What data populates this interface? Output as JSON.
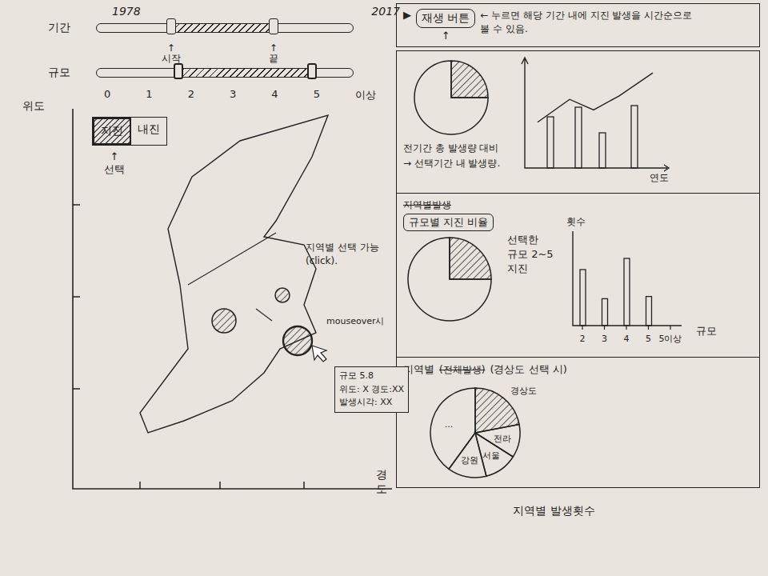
{
  "period": {
    "label": "기간",
    "start_year": "1978",
    "end_year": "2017",
    "start_label": "시작",
    "end_label": "끝",
    "start_level": 0.29,
    "end_level": 0.69
  },
  "magnitude": {
    "label": "규모",
    "ticks": [
      "0",
      "1",
      "2",
      "3",
      "4",
      "5",
      "이상"
    ],
    "start_level": 0.32,
    "end_level": 0.84
  },
  "map": {
    "y_axis": "위도",
    "x_axis": "경도",
    "toggle": [
      {
        "label": "지진",
        "selected": true
      },
      {
        "label": "내진",
        "selected": false
      }
    ],
    "toggle_arrow": "↑",
    "toggle_note": "선택",
    "region_note": "지역별 선택 가능",
    "region_note_2": "(click).",
    "hover_note": "mouseover시",
    "markers": [
      {
        "hovered": false
      },
      {
        "hovered": false
      },
      {
        "hovered": true
      }
    ],
    "tooltip": {
      "magnitude": "규모 5.8",
      "coords": "위도: X 경도:XX",
      "time": "발생시각: XX"
    }
  },
  "play": {
    "icon": "▶",
    "label": "재생 버튼",
    "arrow": "↑",
    "note": "← 누르면 해당 기간 내에 지진 발생을 시간순으로",
    "note_2": "볼 수 있음."
  },
  "period_panel": {
    "slices": [
      {
        "share": 0.25,
        "selected": true
      },
      {
        "share": 0.75,
        "selected": false
      }
    ],
    "bars": [
      3.2,
      3.8,
      2.2,
      3.9
    ],
    "line": [
      2.6,
      3.9,
      3.3,
      4.1,
      5.4
    ],
    "x_axis": "연도",
    "caption": "전기간 총 발생량 대비",
    "caption_2": "→ 선택기간 내 발생량."
  },
  "magnitude_panel": {
    "struck": "지역별발생",
    "title": "규모별 지진 비율",
    "slices": [
      {
        "share": 0.25,
        "selected": true
      },
      {
        "share": 0.75,
        "selected": false
      }
    ],
    "annotation": "선택한",
    "annotation_2": "규모 2~5",
    "annotation_3": "지진",
    "y_axis": "횟수",
    "x_axis": "규모",
    "ticks": [
      "2",
      "3",
      "4",
      "5",
      "5이상"
    ],
    "bars": [
      2.5,
      1.2,
      3.0,
      1.3,
      0
    ]
  },
  "region_panel": {
    "title": "지역별",
    "struck": "(전체발생)",
    "note": "(경상도 선택 시)",
    "slices": [
      {
        "label": "경상도",
        "share": 0.22,
        "selected": true
      },
      {
        "label": "전라",
        "share": 0.12,
        "selected": false
      },
      {
        "label": "서울",
        "share": 0.12,
        "selected": false
      },
      {
        "label": "강원",
        "share": 0.14,
        "selected": false
      },
      {
        "label": "...",
        "share": 0.4,
        "selected": false
      }
    ],
    "caption": "지역별 발생횟수"
  }
}
